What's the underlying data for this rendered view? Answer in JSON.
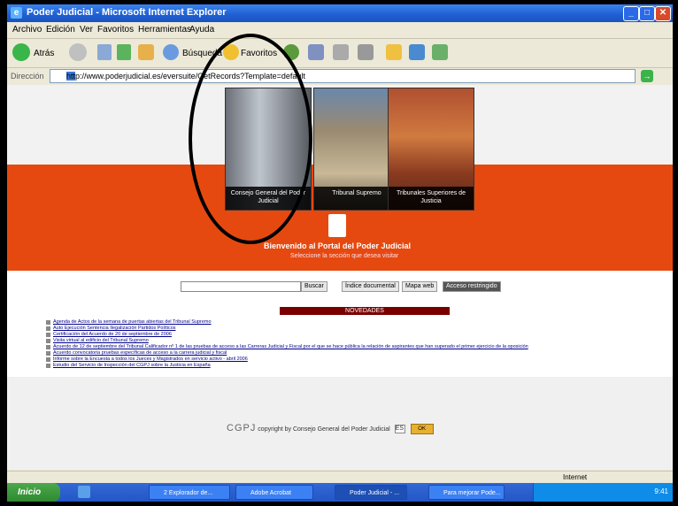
{
  "window": {
    "title": "Poder Judicial - Microsoft Internet Explorer",
    "controls": [
      "_",
      "□",
      "✕"
    ]
  },
  "menu": [
    "Archivo",
    "Edición",
    "Ver",
    "Favoritos",
    "Herramientas",
    "Ayuda"
  ],
  "toolbar": {
    "back": "Atrás",
    "search": "Búsqueda",
    "favorites": "Favoritos"
  },
  "address": {
    "label": "Dirección",
    "url": "http://www.poderjudicial.es/eversuite/GetRecords?Template=default"
  },
  "hero": {
    "photos": [
      {
        "caption": "Consejo General del Poder Judicial"
      },
      {
        "caption": "Tribunal Supremo"
      },
      {
        "caption": "Tribunales Superiores de Justicia"
      }
    ],
    "welcome": "Bienvenido al Portal del Poder Judicial",
    "subtitle": "Seleccione la sección que desea visitar"
  },
  "search": {
    "buttons": [
      "Buscar",
      "Índice documental",
      "Mapa web"
    ],
    "dark_button": "Acceso restringido"
  },
  "news": {
    "title": "NOVEDADES",
    "items": [
      "Agenda de Actos de la semana de puertas abiertas del Tribunal Supremo",
      "Auto Ejecución Sentencia Ilegalización Partidos Políticos",
      "Certificación del Acuerdo de 20 de septiembre de 2006",
      "Visita virtual al edificio del Tribunal Supremo",
      "Acuerdo de 12 de septiembre del Tribunal Calificador nº 1 de las pruebas de acceso a las Carreras Judicial y Fiscal por el que se hace pública la relación de aspirantes que han superado el primer ejercicio de la oposición",
      "Acuerdo convocatoria pruebas específicas de acceso a la carrera judicial y fiscal",
      "Informe sobre la Encuesta a todos los Jueces y Magistrados en servicio activo - abril 2006",
      "Estudio del Servicio de Inspección del CGPJ sobre la Justicia en España"
    ]
  },
  "footer": {
    "logo": "CGPJ",
    "copyright": "copyright by Consejo General del Poder Judicial",
    "lang": "ES",
    "ok": "OK"
  },
  "statusbar": {
    "zone": "Internet"
  },
  "taskbar": {
    "start": "Inicio",
    "tasks": [
      "2 Explorador de...",
      "Adobe Acrobat",
      "Poder Judicial - ...",
      "Para mejorar Pode..."
    ],
    "clock": "9:41"
  }
}
